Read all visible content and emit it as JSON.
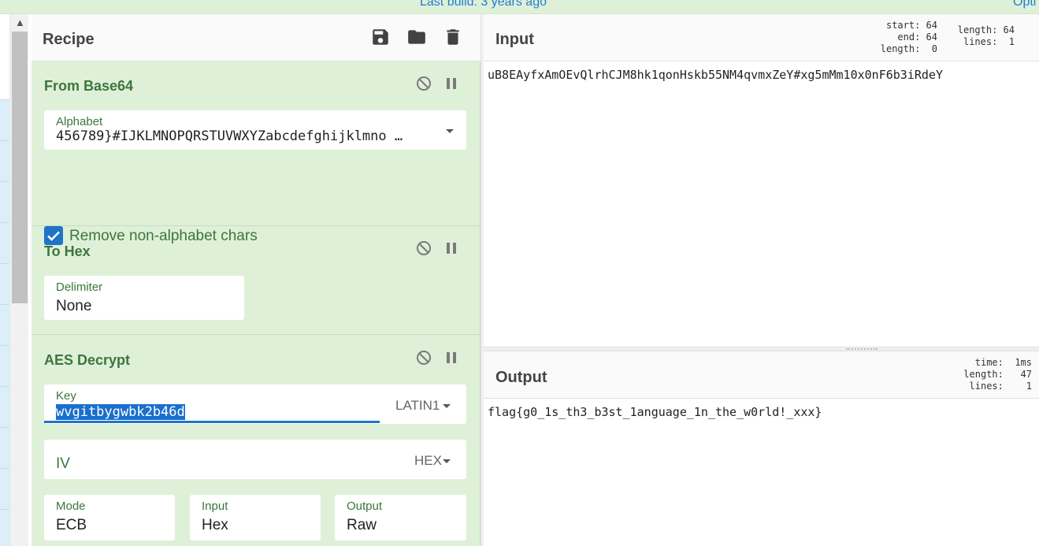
{
  "topbar": {
    "build_text": "Last build: 3 years ago",
    "options_text": "Opti"
  },
  "recipe": {
    "title": "Recipe",
    "icons": {
      "save": "save-icon",
      "load": "folder-icon",
      "clear": "trash-icon"
    },
    "ops": {
      "from_base64": {
        "name": "From Base64",
        "alphabet_label": "Alphabet",
        "alphabet_value": "456789}#IJKLMNOPQRSTUVWXYZabcdefghijklmno",
        "remove_label": "Remove non-alphabet chars",
        "remove_checked": true
      },
      "to_hex": {
        "name": "To Hex",
        "delimiter_label": "Delimiter",
        "delimiter_value": "None"
      },
      "aes_decrypt": {
        "name": "AES Decrypt",
        "key_label": "Key",
        "key_value": "wvgitbygwbk2b46d",
        "key_encoding": "LATIN1",
        "iv_label": "IV",
        "iv_encoding": "HEX",
        "mode_label": "Mode",
        "mode_value": "ECB",
        "input_label": "Input",
        "input_value": "Hex",
        "output_label": "Output",
        "output_value": "Raw"
      }
    }
  },
  "input": {
    "title": "Input",
    "stats_left": "start: 64\n  end: 64\nlength:  0",
    "stats_right": "length: 64\n lines:  1",
    "text": "uB8EAyfxAmOEvQlrhCJM8hk1qonHskb55NM4qvmxZeY#xg5mMm10x0nF6b3iRdeY"
  },
  "output": {
    "title": "Output",
    "stats": "  time:  1ms\nlength:   47\n lines:    1",
    "text": "flag{g0_1s_th3_b3st_1anguage_1n_the_w0rld!_xxx}"
  },
  "colors": {
    "recipe_bg": "#dff0d8",
    "label_green": "#3c763d",
    "accent_blue": "#1f74c9"
  }
}
